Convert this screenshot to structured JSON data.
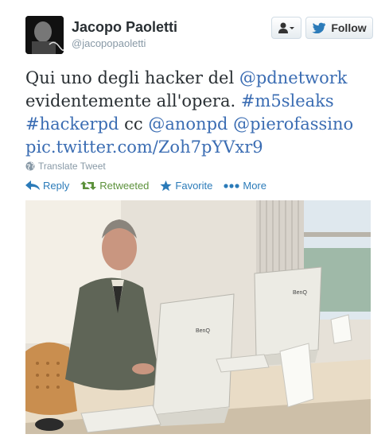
{
  "user": {
    "fullname": "Jacopo Paoletti",
    "username": "@jacopopaoletti"
  },
  "buttons": {
    "follow_label": "Follow",
    "user_menu_icon": "user-dropdown-icon"
  },
  "tweet": {
    "line1_text": "Qui uno degli hacker del ",
    "mention_pdnetwork": "@pdnetwork",
    "line2_text": "evidentemente all'opera. ",
    "hashtag_m5sleaks": "#m5sleaks",
    "hashtag_hackerpd": "#hackerpd",
    "cc": " cc ",
    "mention_anonpd": "@anonpd",
    "mention_pierofassino": "@pierofassino",
    "pic_link": "pic.twitter.com/Zoh7pYVxr9"
  },
  "translate_label": "Translate Tweet",
  "actions": {
    "reply": "Reply",
    "retweeted": "Retweeted",
    "favorite": "Favorite",
    "more": "More"
  },
  "colors": {
    "link": "#3b6db3",
    "action": "#2b7bb9",
    "retweeted": "#5c913b",
    "muted": "#8899a6"
  }
}
